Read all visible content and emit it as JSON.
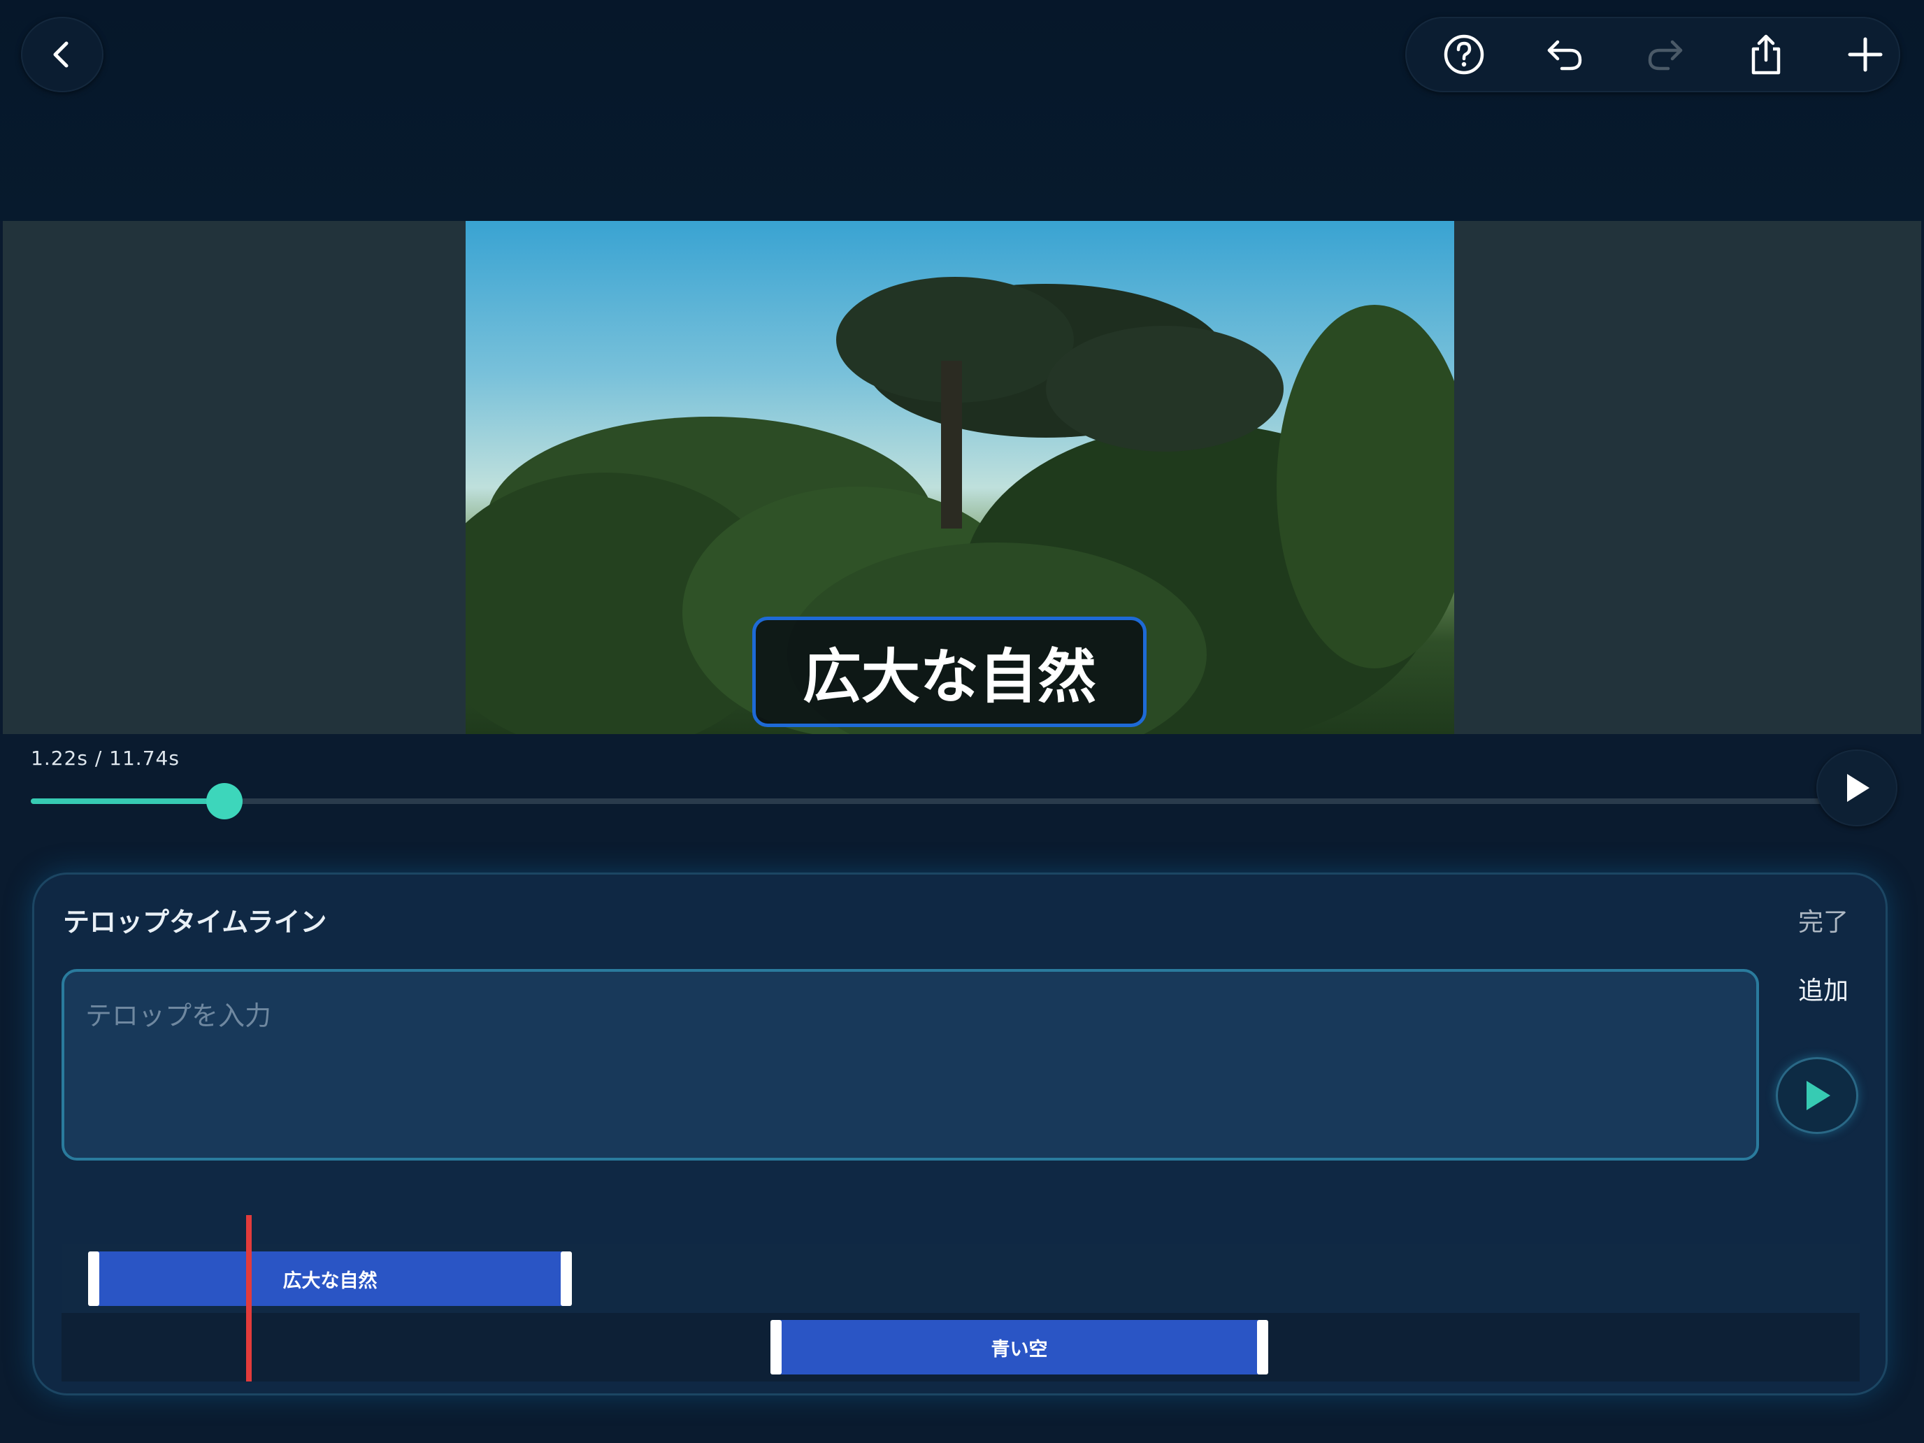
{
  "toolbar": {
    "back_icon": "chevron-left-icon",
    "help_icon": "help-circle-icon",
    "undo_icon": "undo-icon",
    "redo_icon": "redo-icon",
    "share_icon": "share-icon",
    "add_icon": "plus-icon"
  },
  "preview": {
    "caption": "広大な自然"
  },
  "player": {
    "time_display": "1.22s / 11.74s",
    "progress": 0.104,
    "play_icon": "play-icon"
  },
  "panel": {
    "title": "テロップタイムライン",
    "done_label": "完了",
    "add_label": "追加",
    "input_placeholder": "テロップを入力",
    "preview_play_icon": "play-icon"
  },
  "timeline": {
    "clips": [
      {
        "label": "広大な自然",
        "start": 0.0,
        "end": 1.75
      },
      {
        "label": "青い空",
        "start": 2.5,
        "end": 4.5
      }
    ],
    "playhead_time": 1.22
  },
  "colors": {
    "accent_teal": "#37cbb3",
    "clip_blue": "#2a55c5",
    "caption_border": "#1e6ad6",
    "playhead_red": "#e23b3b"
  }
}
